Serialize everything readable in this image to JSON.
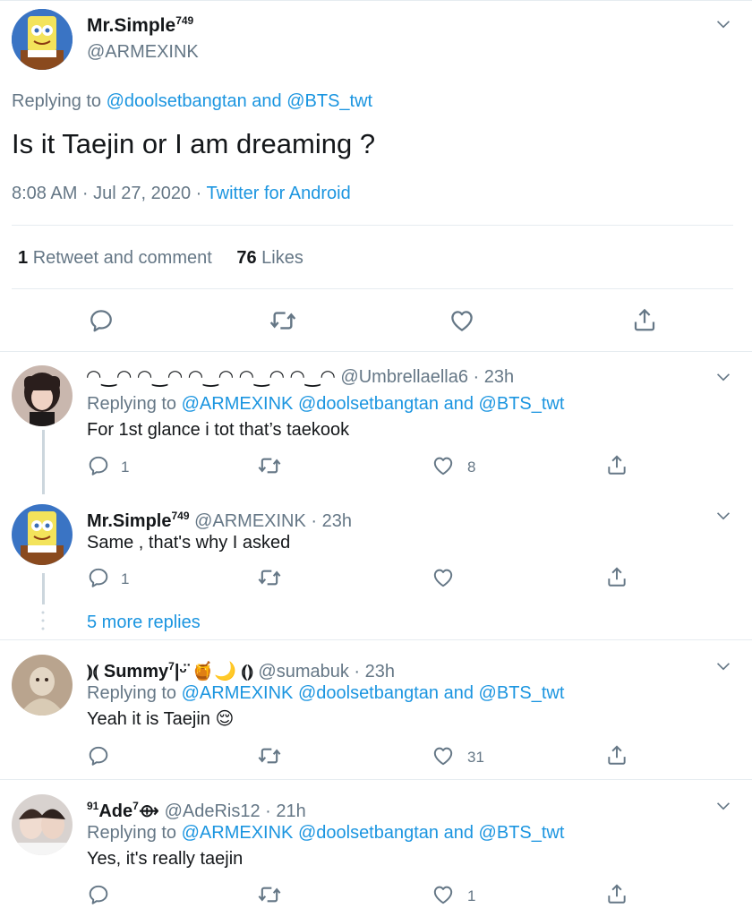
{
  "main_tweet": {
    "display_name": "Mr.Simple",
    "name_suffix": "749",
    "handle": "@ARMEXINK",
    "replying_prefix": "Replying to",
    "replying_user1": "@doolsetbangtan",
    "replying_and": "and",
    "replying_user2": "@BTS_twt",
    "text": "Is it Taejin or I am dreaming ?",
    "time": "8:08 AM · Jul 27, 2020 ·",
    "source": "Twitter for Android",
    "retweet_count": "1",
    "retweet_label": "Retweet and comment",
    "like_count": "76",
    "like_label": "Likes"
  },
  "replies": [
    {
      "display_name": "◠‿◠ ◠‿◠ ◠‿◠ ◠‿◠ ◠‿◠",
      "handle_time": "@Umbrellaella6 · 23h",
      "replying_prefix": "Replying to",
      "replying_users": "@ARMEXINK @doolsetbangtan",
      "replying_and": "and",
      "replying_last": "@BTS_twt",
      "text": "For 1st glance i tot that’s taekook",
      "reply_count": "1",
      "like_count": "8"
    },
    {
      "display_name": "Mr.Simple",
      "name_suffix": "749",
      "handle_time": "@ARMEXINK · 23h",
      "text": "Same , that's why I asked",
      "reply_count": "1",
      "like_count": ""
    },
    {
      "more_replies": "5 more replies"
    },
    {
      "display_name": "⦆⦅ Summy",
      "name_suffix": "7",
      "name_extra": "|ᵕ̈ 🍯🌙 ⦅⦆",
      "handle_time": "@sumabuk · 23h",
      "replying_prefix": "Replying to",
      "replying_users": "@ARMEXINK @doolsetbangtan",
      "replying_and": "and",
      "replying_last": "@BTS_twt",
      "text": "Yeah it is Taejin",
      "emoji": "😌",
      "reply_count": "",
      "like_count": "31"
    },
    {
      "display_name_prefix": "91",
      "display_name": "Ade",
      "name_suffix": "7",
      "name_extra": "⟴",
      "handle_time": "@AdeRis12 · 21h",
      "replying_prefix": "Replying to",
      "replying_users": "@ARMEXINK @doolsetbangtan",
      "replying_and": "and",
      "replying_last": "@BTS_twt",
      "text": "Yes, it's really taejin",
      "reply_count": "",
      "like_count": "1"
    }
  ],
  "icons": {
    "reply": "reply-icon",
    "retweet": "retweet-icon",
    "like": "like-icon",
    "share": "share-icon",
    "more": "chevron-down-icon"
  },
  "colors": {
    "link": "#1b95e0",
    "secondary": "#657786",
    "divider": "#e6ecf0"
  }
}
